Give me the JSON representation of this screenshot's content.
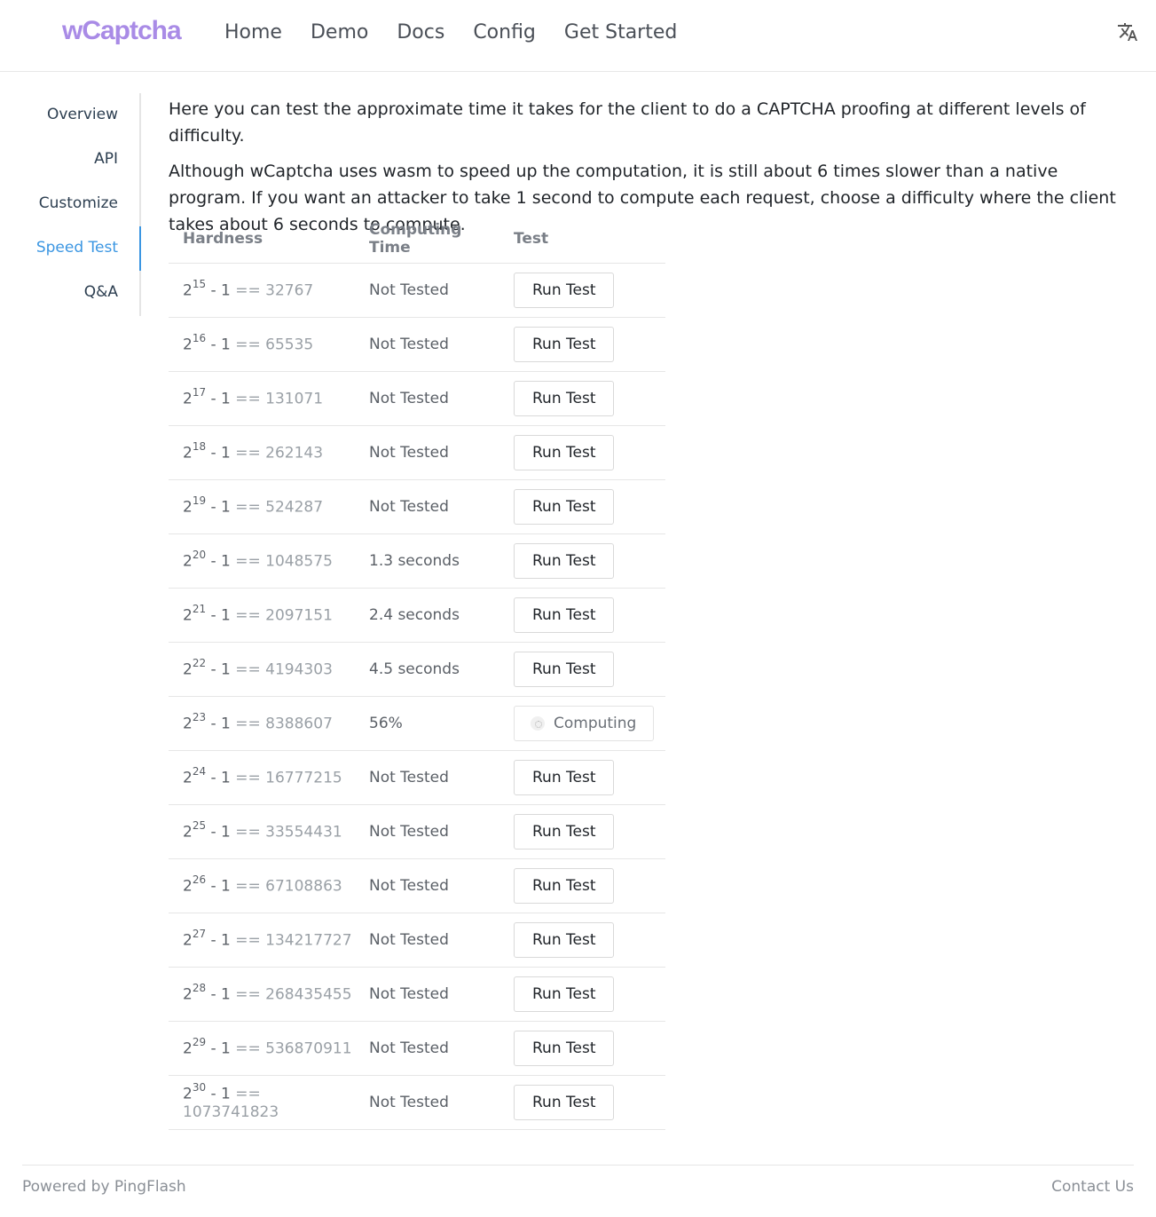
{
  "header": {
    "logo": "wCaptcha",
    "nav": [
      "Home",
      "Demo",
      "Docs",
      "Config",
      "Get Started"
    ],
    "translate_icon": "translate-icon"
  },
  "sidebar": {
    "items": [
      "Overview",
      "API",
      "Customize",
      "Speed Test",
      "Q&A"
    ],
    "active": "Speed Test"
  },
  "content": {
    "intro": "Here you can test the approximate time it takes for the client to do a CAPTCHA proofing at different levels of difficulty.",
    "note": "Although wCaptcha uses wasm to speed up the computation, it is still about 6 times slower than a native program. If you want an attacker to take 1 second to compute each request, choose a difficulty where the client takes about 6 seconds to compute."
  },
  "table": {
    "headers": [
      "Hardness",
      "Computing Time",
      "Test"
    ],
    "rows": [
      {
        "base": "2",
        "exp": "15",
        "minus": "- 1",
        "eq": "== 32767",
        "time": "Not Tested",
        "button": "Run Test"
      },
      {
        "base": "2",
        "exp": "16",
        "minus": "- 1",
        "eq": "== 65535",
        "time": "Not Tested",
        "button": "Run Test"
      },
      {
        "base": "2",
        "exp": "17",
        "minus": "- 1",
        "eq": "== 131071",
        "time": "Not Tested",
        "button": "Run Test"
      },
      {
        "base": "2",
        "exp": "18",
        "minus": "- 1",
        "eq": "== 262143",
        "time": "Not Tested",
        "button": "Run Test"
      },
      {
        "base": "2",
        "exp": "19",
        "minus": "- 1",
        "eq": "== 524287",
        "time": "Not Tested",
        "button": "Run Test"
      },
      {
        "base": "2",
        "exp": "20",
        "minus": "- 1",
        "eq": "== 1048575",
        "time": "1.3 seconds",
        "button": "Run Test"
      },
      {
        "base": "2",
        "exp": "21",
        "minus": "- 1",
        "eq": "== 2097151",
        "time": "2.4 seconds",
        "button": "Run Test"
      },
      {
        "base": "2",
        "exp": "22",
        "minus": "- 1",
        "eq": "== 4194303",
        "time": "4.5 seconds",
        "button": "Run Test"
      },
      {
        "base": "2",
        "exp": "23",
        "minus": "- 1",
        "eq": "== 8388607",
        "time": "56%",
        "button": "Computing",
        "computing": true
      },
      {
        "base": "2",
        "exp": "24",
        "minus": "- 1",
        "eq": "== 16777215",
        "time": "Not Tested",
        "button": "Run Test"
      },
      {
        "base": "2",
        "exp": "25",
        "minus": "- 1",
        "eq": "== 33554431",
        "time": "Not Tested",
        "button": "Run Test"
      },
      {
        "base": "2",
        "exp": "26",
        "minus": "- 1",
        "eq": "== 67108863",
        "time": "Not Tested",
        "button": "Run Test"
      },
      {
        "base": "2",
        "exp": "27",
        "minus": "- 1",
        "eq": "== 134217727",
        "time": "Not Tested",
        "button": "Run Test"
      },
      {
        "base": "2",
        "exp": "28",
        "minus": "- 1",
        "eq": "== 268435455",
        "time": "Not Tested",
        "button": "Run Test"
      },
      {
        "base": "2",
        "exp": "29",
        "minus": "- 1",
        "eq": "== 536870911",
        "time": "Not Tested",
        "button": "Run Test"
      },
      {
        "base": "2",
        "exp": "30",
        "minus": "- 1",
        "eq": "== 1073741823",
        "time": "Not Tested",
        "button": "Run Test"
      }
    ]
  },
  "footer": {
    "left": "Powered by PingFlash",
    "right": "Contact Us"
  },
  "colors": {
    "logo": "#a98be6",
    "active": "#3b96e2"
  }
}
